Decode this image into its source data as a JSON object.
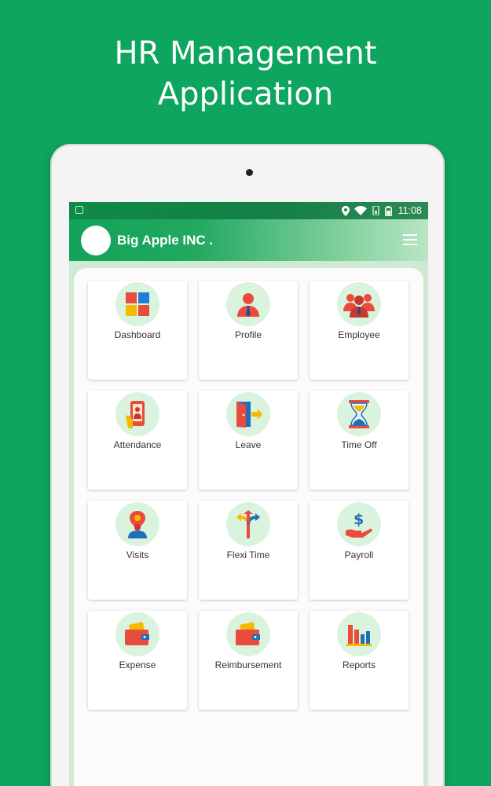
{
  "promo": {
    "title_line1": "HR Management",
    "title_line2": "Application"
  },
  "status_bar": {
    "time": "11:08",
    "icons": [
      "notification-icon",
      "location-icon",
      "wifi-icon",
      "signal-icon",
      "battery-icon"
    ]
  },
  "app_bar": {
    "company_name": "Big Apple INC .",
    "menu_icon": "hamburger-menu-icon"
  },
  "colors": {
    "background": "#0ea55e",
    "app_bar_start": "#11a35a",
    "icon_circle": "#daf3de"
  },
  "menu": {
    "items": [
      {
        "label": "Dashboard",
        "icon": "dashboard-icon"
      },
      {
        "label": "Profile",
        "icon": "profile-icon"
      },
      {
        "label": "Employee",
        "icon": "employee-icon"
      },
      {
        "label": "Attendance",
        "icon": "attendance-icon"
      },
      {
        "label": "Leave",
        "icon": "leave-icon"
      },
      {
        "label": "Time Off",
        "icon": "hourglass-icon"
      },
      {
        "label": "Visits",
        "icon": "visits-icon"
      },
      {
        "label": "Flexi Time",
        "icon": "flexi-time-icon"
      },
      {
        "label": "Payroll",
        "icon": "payroll-icon"
      },
      {
        "label": "Expense",
        "icon": "wallet-icon"
      },
      {
        "label": "Reimbursement",
        "icon": "wallet-icon"
      },
      {
        "label": "Reports",
        "icon": "bar-chart-icon"
      }
    ]
  }
}
